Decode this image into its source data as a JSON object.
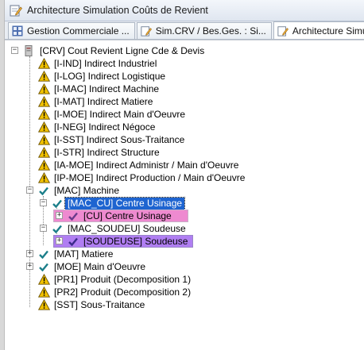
{
  "window": {
    "title": "Architecture Simulation Coûts de Revient"
  },
  "tabs": [
    {
      "label": "Gestion Commerciale ..."
    },
    {
      "label": "Sim.CRV / Bes.Ges. : Si..."
    },
    {
      "label": "Architecture Simul"
    }
  ],
  "tree": {
    "root": {
      "label": "[CRV] Cout Revient Ligne Cde & Devis"
    },
    "items": [
      {
        "label": "[I-IND] Indirect Industriel",
        "icon": "warning-icon"
      },
      {
        "label": "[I-LOG] Indirect Logistique",
        "icon": "warning-icon"
      },
      {
        "label": "[I-MAC] Indirect Machine",
        "icon": "warning-icon"
      },
      {
        "label": "[I-MAT] Indirect Matiere",
        "icon": "warning-icon"
      },
      {
        "label": "[I-MOE] Indirect Main d'Oeuvre",
        "icon": "warning-icon"
      },
      {
        "label": "[I-NEG] Indirect Négoce",
        "icon": "warning-icon"
      },
      {
        "label": "[I-SST] Indirect Sous-Traitance",
        "icon": "warning-icon"
      },
      {
        "label": "[I-STR] Indirect Structure",
        "icon": "warning-icon"
      },
      {
        "label": "[IA-MOE] Indirect Administr / Main d'Oeuvre",
        "icon": "warning-icon"
      },
      {
        "label": "[IP-MOE] Indirect Production / Main d'Oeuvre",
        "icon": "warning-icon"
      },
      {
        "label": "[MAC] Machine",
        "icon": "check-icon"
      },
      {
        "label": "[MAC_CU] Centre Usinage",
        "icon": "check-icon"
      },
      {
        "label": "[CU] Centre Usinage",
        "icon": "check-icon"
      },
      {
        "label": "[MAC_SOUDEU] Soudeuse",
        "icon": "check-icon"
      },
      {
        "label": "[SOUDEUSE] Soudeuse",
        "icon": "check-icon"
      },
      {
        "label": "[MAT] Matiere",
        "icon": "check-icon"
      },
      {
        "label": "[MOE] Main d'Oeuvre",
        "icon": "check-icon"
      },
      {
        "label": "[PR1] Produit (Decomposition 1)",
        "icon": "warning-icon"
      },
      {
        "label": "[PR2] Produit (Decomposition 2)",
        "icon": "warning-icon"
      },
      {
        "label": "[SST] Sous-Traitance",
        "icon": "warning-icon"
      }
    ]
  },
  "colors": {
    "selection": "#1e64d0",
    "highlight_pink": "#ee8ad0",
    "highlight_purple": "#b07ef2",
    "check": "#1c7f8a",
    "warning": "#f2c200"
  }
}
